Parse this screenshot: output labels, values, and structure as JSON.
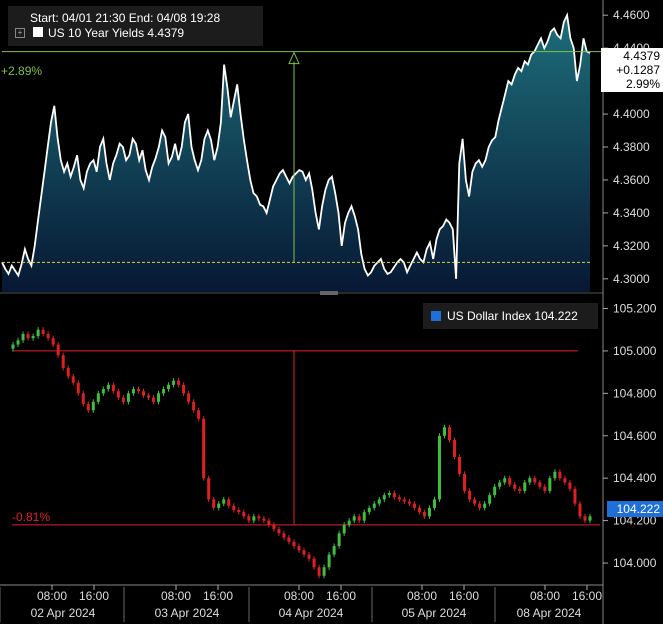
{
  "header": {
    "range_text": "Start: 04/01 21:30 End: 04/08 19:28",
    "series_label": "US 10 Year Yields 4.4379"
  },
  "colors": {
    "yield_line": "#ffffff",
    "area_top": "#1d6e7a",
    "area_bottom": "#071833",
    "baseline": "#e0d040",
    "measure": "#7fc24a",
    "red_level": "#e0202a",
    "candle_up": "#3fbf3f",
    "candle_down": "#e02020",
    "tag_blue": "#1f6fd9"
  },
  "annotations": {
    "top_change": "+2.89%",
    "top_tag": [
      "4.4379",
      "+0.1287",
      "2.99%"
    ],
    "bottom_change": "-0.81%",
    "bottom_tag": "104.222"
  },
  "chart_data": [
    {
      "type": "area",
      "title": "",
      "series": [
        {
          "name": "US 10 Year Yields",
          "last": 4.4379,
          "x_label_note": "",
          "values": [
            4.31,
            4.306,
            4.303,
            4.308,
            4.305,
            4.302,
            4.309,
            4.318,
            4.312,
            4.308,
            4.32,
            4.335,
            4.35,
            4.365,
            4.38,
            4.395,
            4.405,
            4.386,
            4.372,
            4.365,
            4.37,
            4.362,
            4.368,
            4.375,
            4.36,
            4.355,
            4.365,
            4.37,
            4.372,
            4.365,
            4.38,
            4.385,
            4.37,
            4.36,
            4.37,
            4.375,
            4.382,
            4.38,
            4.372,
            4.375,
            4.385,
            4.382,
            4.372,
            4.378,
            4.366,
            4.36,
            4.368,
            4.373,
            4.38,
            4.39,
            4.386,
            4.37,
            4.374,
            4.382,
            4.372,
            4.38,
            4.395,
            4.4,
            4.38,
            4.372,
            4.366,
            4.372,
            4.385,
            4.39,
            4.384,
            4.372,
            4.38,
            4.395,
            4.43,
            4.416,
            4.398,
            4.408,
            4.418,
            4.4,
            4.385,
            4.372,
            4.36,
            4.352,
            4.35,
            4.345,
            4.344,
            4.34,
            4.348,
            4.356,
            4.36,
            4.364,
            4.366,
            4.362,
            4.358,
            4.362,
            4.364,
            4.366,
            4.365,
            4.36,
            4.364,
            4.354,
            4.34,
            4.33,
            4.344,
            4.354,
            4.36,
            4.362,
            4.352,
            4.34,
            4.32,
            4.334,
            4.34,
            4.344,
            4.338,
            4.33,
            4.315,
            4.306,
            4.302,
            4.304,
            4.308,
            4.31,
            4.312,
            4.306,
            4.303,
            4.304,
            4.307,
            4.31,
            4.312,
            4.31,
            4.304,
            4.308,
            4.312,
            4.316,
            4.312,
            4.31,
            4.318,
            4.322,
            4.312,
            4.324,
            4.33,
            4.332,
            4.336,
            4.334,
            4.33,
            4.3,
            4.37,
            4.385,
            4.36,
            4.35,
            4.365,
            4.37,
            4.372,
            4.368,
            4.372,
            4.38,
            4.384,
            4.386,
            4.396,
            4.404,
            4.412,
            4.42,
            4.418,
            4.424,
            4.428,
            4.426,
            4.432,
            4.43,
            4.436,
            4.438,
            4.442,
            4.446,
            4.44,
            4.444,
            4.45,
            4.452,
            4.448,
            4.446,
            4.456,
            4.46,
            4.446,
            4.44,
            4.42,
            4.43,
            4.446,
            4.438,
            4.437
          ]
        }
      ],
      "ylim": [
        4.292,
        4.468
      ],
      "y_ticks": [
        "4.3000",
        "4.3200",
        "4.3400",
        "4.3600",
        "4.3800",
        "4.4000",
        "4.4200",
        "4.4400",
        "4.4600"
      ],
      "baseline_value": 4.31,
      "reference_value": 4.4379,
      "grid": false
    },
    {
      "type": "candlestick",
      "title": "",
      "series": [
        {
          "name": "US Dollar Index",
          "last": 104.222,
          "values": [
            105.01,
            105.03,
            105.05,
            105.08,
            105.06,
            105.07,
            105.1,
            105.08,
            105.06,
            105.03,
            104.98,
            104.92,
            104.88,
            104.85,
            104.8,
            104.75,
            104.72,
            104.76,
            104.8,
            104.82,
            104.84,
            104.81,
            104.78,
            104.76,
            104.8,
            104.82,
            104.81,
            104.79,
            104.78,
            104.76,
            104.8,
            104.82,
            104.84,
            104.86,
            104.84,
            104.8,
            104.76,
            104.72,
            104.68,
            104.4,
            104.3,
            104.26,
            104.28,
            104.3,
            104.27,
            104.25,
            104.24,
            104.22,
            104.2,
            104.22,
            104.21,
            104.2,
            104.18,
            104.16,
            104.14,
            104.12,
            104.1,
            104.08,
            104.06,
            104.04,
            104.02,
            103.98,
            103.94,
            103.98,
            104.04,
            104.08,
            104.14,
            104.18,
            104.2,
            104.22,
            104.2,
            104.24,
            104.26,
            104.28,
            104.3,
            104.32,
            104.33,
            104.31,
            104.3,
            104.29,
            104.28,
            104.26,
            104.24,
            104.22,
            104.26,
            104.3,
            104.6,
            104.64,
            104.58,
            104.5,
            104.42,
            104.34,
            104.3,
            104.28,
            104.26,
            104.28,
            104.32,
            104.36,
            104.38,
            104.4,
            104.37,
            104.35,
            104.34,
            104.38,
            104.4,
            104.38,
            104.36,
            104.34,
            104.4,
            104.43,
            104.4,
            104.38,
            104.35,
            104.28,
            104.22,
            104.2,
            104.22
          ]
        }
      ],
      "ylim": [
        103.92,
        105.24
      ],
      "y_ticks": [
        "104.000",
        "104.200",
        "104.400",
        "104.600",
        "104.800",
        "105.000",
        "105.200"
      ],
      "reference_value": 105.0,
      "min_level": 104.18,
      "grid": false
    }
  ],
  "x_axis": {
    "time_ticks": [
      "08:00",
      "16:00",
      "08:00",
      "16:00",
      "08:00",
      "16:00",
      "08:00",
      "16:00",
      "08:00",
      "16:00"
    ],
    "date_ticks": [
      "02 Apr 2024",
      "03 Apr 2024",
      "04 Apr 2024",
      "05 Apr 2024",
      "08 Apr 2024"
    ]
  }
}
